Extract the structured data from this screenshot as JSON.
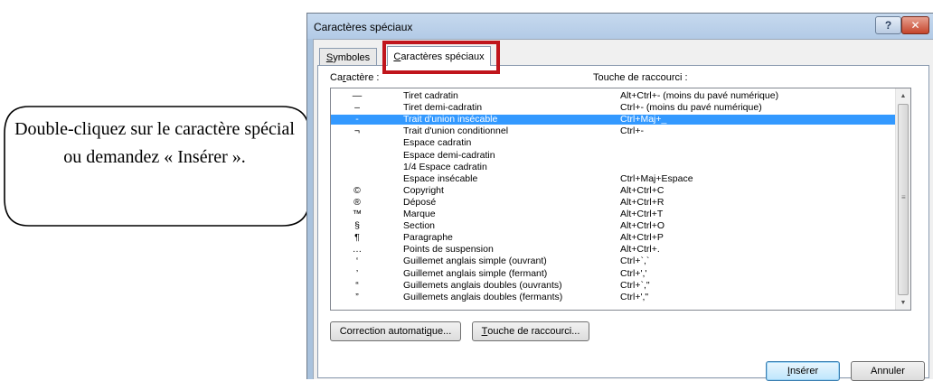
{
  "callout": {
    "text": "Double-cliquez sur le caractère spécial ou demandez « Insérer »."
  },
  "dialog": {
    "title": "Caractères spéciaux",
    "help_label": "?",
    "close_label": "✕",
    "tabs": [
      {
        "label": "Symboles",
        "mnemonic": "S",
        "rest": "ymboles",
        "active": false
      },
      {
        "label": "Caractères spéciaux",
        "mnemonic": "C",
        "rest": "aractères spéciaux",
        "active": true
      }
    ],
    "columns": {
      "character": "Caractère :",
      "char_prefix": "Ca",
      "char_mnemonic": "r",
      "char_rest": "actère :",
      "shortcut": "Touche de raccourci :"
    },
    "selected_index": 2,
    "rows": [
      {
        "char": "—",
        "name": "Tiret cadratin",
        "shortcut": "Alt+Ctrl+- (moins du pavé numérique)"
      },
      {
        "char": "–",
        "name": "Tiret demi-cadratin",
        "shortcut": "Ctrl+- (moins du pavé numérique)"
      },
      {
        "char": "-",
        "name": "Trait d'union insécable",
        "shortcut": "Ctrl+Maj+_"
      },
      {
        "char": "¬",
        "name": "Trait d'union conditionnel",
        "shortcut": "Ctrl+-"
      },
      {
        "char": "",
        "name": "Espace cadratin",
        "shortcut": ""
      },
      {
        "char": "",
        "name": "Espace demi-cadratin",
        "shortcut": ""
      },
      {
        "char": "",
        "name": "1/4 Espace cadratin",
        "shortcut": ""
      },
      {
        "char": "",
        "name": "Espace insécable",
        "shortcut": "Ctrl+Maj+Espace"
      },
      {
        "char": "©",
        "name": "Copyright",
        "shortcut": "Alt+Ctrl+C"
      },
      {
        "char": "®",
        "name": "Déposé",
        "shortcut": "Alt+Ctrl+R"
      },
      {
        "char": "™",
        "name": "Marque",
        "shortcut": "Alt+Ctrl+T"
      },
      {
        "char": "§",
        "name": "Section",
        "shortcut": "Alt+Ctrl+O"
      },
      {
        "char": "¶",
        "name": "Paragraphe",
        "shortcut": "Alt+Ctrl+P"
      },
      {
        "char": "…",
        "name": "Points de suspension",
        "shortcut": "Alt+Ctrl+."
      },
      {
        "char": "‘",
        "name": "Guillemet anglais simple (ouvrant)",
        "shortcut": "Ctrl+`,`"
      },
      {
        "char": "’",
        "name": "Guillemet anglais simple (fermant)",
        "shortcut": "Ctrl+','"
      },
      {
        "char": "“",
        "name": "Guillemets anglais doubles (ouvrants)",
        "shortcut": "Ctrl+`,\""
      },
      {
        "char": "”",
        "name": "Guillemets anglais doubles (fermants)",
        "shortcut": "Ctrl+',\""
      }
    ],
    "buttons": {
      "autocorrect": {
        "label": "Correction automatique...",
        "pre": "Correction automati",
        "mnemonic": "q",
        "post": "ue..."
      },
      "shortcut_key": {
        "label": "Touche de raccourci...",
        "pre": "",
        "mnemonic": "T",
        "post": "ouche de raccourci..."
      },
      "insert": {
        "label": "Insérer",
        "pre": "",
        "mnemonic": "I",
        "post": "nsérer"
      },
      "cancel": {
        "label": "Annuler"
      }
    }
  },
  "colors": {
    "selection": "#3399ff",
    "highlight_box": "#c0151c",
    "title_bar": "#b9cfe8"
  }
}
